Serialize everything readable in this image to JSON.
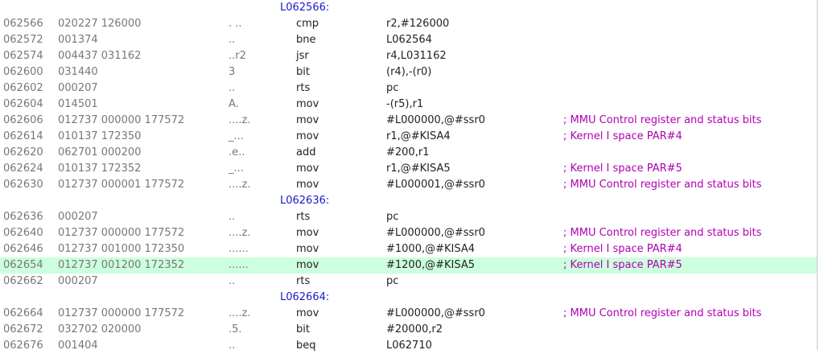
{
  "listing": {
    "rows": [
      {
        "type": "label",
        "text": "L062566:"
      },
      {
        "type": "code",
        "addr": "062566",
        "octal": "020227 126000",
        "ascii": ". ..",
        "mnemonic": "cmp",
        "operands": "r2,#126000",
        "comment": ""
      },
      {
        "type": "code",
        "addr": "062572",
        "octal": "001374",
        "ascii": "..",
        "mnemonic": "bne",
        "operands": "L062564",
        "comment": ""
      },
      {
        "type": "code",
        "addr": "062574",
        "octal": "004437 031162",
        "ascii": "..r2",
        "mnemonic": "jsr",
        "operands": "r4,L031162",
        "comment": ""
      },
      {
        "type": "code",
        "addr": "062600",
        "octal": "031440",
        "ascii": " 3",
        "mnemonic": "bit",
        "operands": "(r4),-(r0)",
        "comment": ""
      },
      {
        "type": "code",
        "addr": "062602",
        "octal": "000207",
        "ascii": "..",
        "mnemonic": "rts",
        "operands": "pc",
        "comment": ""
      },
      {
        "type": "code",
        "addr": "062604",
        "octal": "014501",
        "ascii": "A.",
        "mnemonic": "mov",
        "operands": "-(r5),r1",
        "comment": ""
      },
      {
        "type": "code",
        "addr": "062606",
        "octal": "012737 000000 177572",
        "ascii": "....z.",
        "mnemonic": "mov",
        "operands": "#L000000,@#ssr0",
        "comment": "; MMU Control register and status bits"
      },
      {
        "type": "code",
        "addr": "062614",
        "octal": "010137 172350",
        "ascii": "_...",
        "mnemonic": "mov",
        "operands": "r1,@#KISA4",
        "comment": "; Kernel I space PAR#4"
      },
      {
        "type": "code",
        "addr": "062620",
        "octal": "062701 000200",
        "ascii": ".e..",
        "mnemonic": "add",
        "operands": "#200,r1",
        "comment": ""
      },
      {
        "type": "code",
        "addr": "062624",
        "octal": "010137 172352",
        "ascii": "_...",
        "mnemonic": "mov",
        "operands": "r1,@#KISA5",
        "comment": "; Kernel I space PAR#5"
      },
      {
        "type": "code",
        "addr": "062630",
        "octal": "012737 000001 177572",
        "ascii": "....z.",
        "mnemonic": "mov",
        "operands": "#L000001,@#ssr0",
        "comment": "; MMU Control register and status bits"
      },
      {
        "type": "label",
        "text": "L062636:"
      },
      {
        "type": "code",
        "addr": "062636",
        "octal": "000207",
        "ascii": "..",
        "mnemonic": "rts",
        "operands": "pc",
        "comment": ""
      },
      {
        "type": "code",
        "addr": "062640",
        "octal": "012737 000000 177572",
        "ascii": "....z.",
        "mnemonic": "mov",
        "operands": "#L000000,@#ssr0",
        "comment": "; MMU Control register and status bits"
      },
      {
        "type": "code",
        "addr": "062646",
        "octal": "012737 001000 172350",
        "ascii": "......",
        "mnemonic": "mov",
        "operands": "#1000,@#KISA4",
        "comment": "; Kernel I space PAR#4"
      },
      {
        "type": "code",
        "addr": "062654",
        "octal": "012737 001200 172352",
        "ascii": "......",
        "mnemonic": "mov",
        "operands": "#1200,@#KISA5",
        "comment": "; Kernel I space PAR#5",
        "highlight": true
      },
      {
        "type": "code",
        "addr": "062662",
        "octal": "000207",
        "ascii": "..",
        "mnemonic": "rts",
        "operands": "pc",
        "comment": ""
      },
      {
        "type": "label",
        "text": "L062664:"
      },
      {
        "type": "code",
        "addr": "062664",
        "octal": "012737 000000 177572",
        "ascii": "....z.",
        "mnemonic": "mov",
        "operands": "#L000000,@#ssr0",
        "comment": "; MMU Control register and status bits"
      },
      {
        "type": "code",
        "addr": "062672",
        "octal": "032702 020000",
        "ascii": ".5.",
        "mnemonic": "bit",
        "operands": "#20000,r2",
        "comment": ""
      },
      {
        "type": "code",
        "addr": "062676",
        "octal": "001404",
        "ascii": "..",
        "mnemonic": "beq",
        "operands": "L062710",
        "comment": ""
      }
    ]
  },
  "colors": {
    "highlight": "#ccffdd",
    "label": "#1a1acc",
    "comment": "#b000b0",
    "dim": "#777777"
  }
}
